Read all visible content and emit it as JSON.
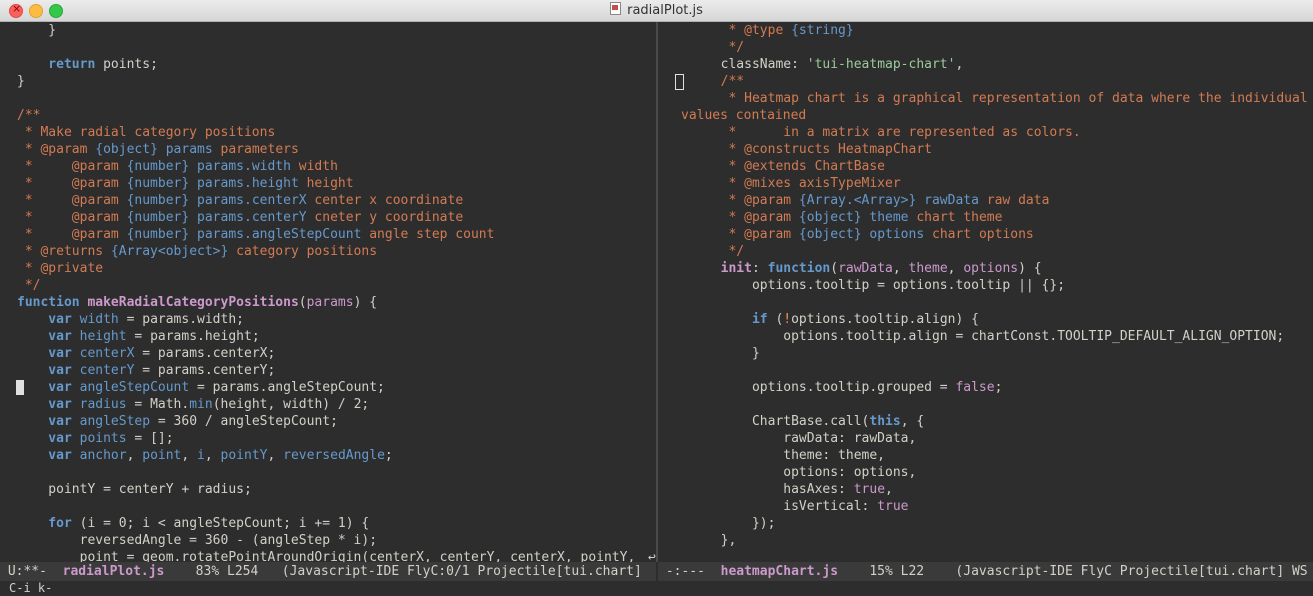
{
  "window": {
    "title": "radialPlot.js"
  },
  "left_pane": {
    "lines": [
      [
        [
          "",
          "    }"
        ]
      ],
      [
        [
          "",
          ""
        ]
      ],
      [
        [
          "k",
          "    return"
        ],
        [
          "",
          " points;"
        ]
      ],
      [
        [
          "",
          "}"
        ]
      ],
      [
        [
          "",
          ""
        ]
      ],
      [
        [
          "c",
          "/**"
        ]
      ],
      [
        [
          "c",
          " * Make radial category positions"
        ]
      ],
      [
        [
          "c",
          " * @param "
        ],
        [
          "t",
          "{object}"
        ],
        [
          "v",
          " params"
        ],
        [
          "c",
          " parameters"
        ]
      ],
      [
        [
          "c",
          " *     @param "
        ],
        [
          "t",
          "{number}"
        ],
        [
          "v",
          " params.width"
        ],
        [
          "c",
          " width"
        ]
      ],
      [
        [
          "c",
          " *     @param "
        ],
        [
          "t",
          "{number}"
        ],
        [
          "v",
          " params.height"
        ],
        [
          "c",
          " height"
        ]
      ],
      [
        [
          "c",
          " *     @param "
        ],
        [
          "t",
          "{number}"
        ],
        [
          "v",
          " params.centerX"
        ],
        [
          "c",
          " center x coordinate"
        ]
      ],
      [
        [
          "c",
          " *     @param "
        ],
        [
          "t",
          "{number}"
        ],
        [
          "v",
          " params.centerY"
        ],
        [
          "c",
          " cneter y coordinate"
        ]
      ],
      [
        [
          "c",
          " *     @param "
        ],
        [
          "t",
          "{number}"
        ],
        [
          "v",
          " params.angleStepCount"
        ],
        [
          "c",
          " angle step count"
        ]
      ],
      [
        [
          "c",
          " * @returns "
        ],
        [
          "t",
          "{Array<object>}"
        ],
        [
          "c",
          " category positions"
        ]
      ],
      [
        [
          "c",
          " * @private"
        ]
      ],
      [
        [
          "c",
          " */"
        ]
      ],
      [
        [
          "k",
          "function"
        ],
        [
          "",
          " "
        ],
        [
          "f",
          "makeRadialCategoryPositions"
        ],
        [
          "",
          "("
        ],
        [
          "p",
          "params"
        ],
        [
          "",
          ") {"
        ]
      ],
      [
        [
          "k",
          "    var"
        ],
        [
          "v",
          " width"
        ],
        [
          "",
          " = params.width;"
        ]
      ],
      [
        [
          "k",
          "    var"
        ],
        [
          "v",
          " height"
        ],
        [
          "",
          " = params.height;"
        ]
      ],
      [
        [
          "k",
          "    var"
        ],
        [
          "v",
          " centerX"
        ],
        [
          "",
          " = params.centerX;"
        ]
      ],
      [
        [
          "k",
          "    var"
        ],
        [
          "v",
          " centerY"
        ],
        [
          "",
          " = params.centerY;"
        ]
      ],
      [
        [
          "k",
          "    var"
        ],
        [
          "v",
          " angleStepCount"
        ],
        [
          "",
          " = params.angleStepCount;"
        ]
      ],
      [
        [
          "k",
          "    var"
        ],
        [
          "v",
          " radius"
        ],
        [
          "",
          " = Math."
        ],
        [
          "m",
          "min"
        ],
        [
          "",
          "(height, width) / 2;"
        ]
      ],
      [
        [
          "k",
          "    var"
        ],
        [
          "v",
          " angleStep"
        ],
        [
          "",
          " = 360 / angleStepCount;"
        ]
      ],
      [
        [
          "k",
          "    var"
        ],
        [
          "v",
          " points"
        ],
        [
          "",
          " = [];"
        ]
      ],
      [
        [
          "k",
          "    var"
        ],
        [
          "v",
          " anchor"
        ],
        [
          "",
          ", "
        ],
        [
          "v",
          "point"
        ],
        [
          "",
          ", "
        ],
        [
          "v",
          "i"
        ],
        [
          "",
          ", "
        ],
        [
          "v",
          "pointY"
        ],
        [
          "",
          ", "
        ],
        [
          "v",
          "reversedAngle"
        ],
        [
          "",
          ";"
        ]
      ],
      [
        [
          "",
          ""
        ]
      ],
      [
        [
          "",
          "    pointY = centerY + radius;"
        ]
      ],
      [
        [
          "",
          ""
        ]
      ],
      [
        [
          "k",
          "    for"
        ],
        [
          "",
          " (i = 0; i < angleStepCount; i += 1) {"
        ]
      ],
      [
        [
          "",
          "        reversedAngle = 360 - (angleStep * i);"
        ]
      ],
      [
        [
          "",
          "        point = geom.rotatePointAroundOrigin(centerX, centerY, centerX, pointY,"
        ]
      ]
    ]
  },
  "right_pane": {
    "lines": [
      [
        [
          "c",
          "   * @type "
        ],
        [
          "t",
          "{string}"
        ]
      ],
      [
        [
          "c",
          "   */"
        ]
      ],
      [
        [
          "",
          "  className: "
        ],
        [
          "s",
          "'tui-heatmap-chart'"
        ],
        [
          "",
          ","
        ]
      ],
      [
        [
          "c",
          "  /**"
        ]
      ],
      [
        [
          "c",
          "   * Heatmap chart is a graphical representation of data where the individual"
        ]
      ],
      [
        [
          "c",
          "values contained"
        ]
      ],
      [
        [
          "c",
          "   *      in a matrix are represented as colors."
        ]
      ],
      [
        [
          "c",
          "   * @constructs HeatmapChart"
        ]
      ],
      [
        [
          "c",
          "   * @extends ChartBase"
        ]
      ],
      [
        [
          "c",
          "   * @mixes axisTypeMixer"
        ]
      ],
      [
        [
          "c",
          "   * @param "
        ],
        [
          "t",
          "{Array.<Array>}"
        ],
        [
          "v",
          " rawData"
        ],
        [
          "c",
          " raw data"
        ]
      ],
      [
        [
          "c",
          "   * @param "
        ],
        [
          "t",
          "{object}"
        ],
        [
          "v",
          " theme"
        ],
        [
          "c",
          " chart theme"
        ]
      ],
      [
        [
          "c",
          "   * @param "
        ],
        [
          "t",
          "{object}"
        ],
        [
          "v",
          " options"
        ],
        [
          "c",
          " chart options"
        ]
      ],
      [
        [
          "c",
          "   */"
        ]
      ],
      [
        [
          "f",
          "  init"
        ],
        [
          "",
          ": "
        ],
        [
          "k",
          "function"
        ],
        [
          "",
          "("
        ],
        [
          "p",
          "rawData"
        ],
        [
          "",
          ", "
        ],
        [
          "p",
          "theme"
        ],
        [
          "",
          ", "
        ],
        [
          "p",
          "options"
        ],
        [
          "",
          ") {"
        ]
      ],
      [
        [
          "",
          "      options.tooltip = options.tooltip || {};"
        ]
      ],
      [
        [
          "",
          ""
        ]
      ],
      [
        [
          "k",
          "      if"
        ],
        [
          "",
          " ("
        ],
        [
          "n",
          "!"
        ],
        [
          "",
          "options.tooltip.align) {"
        ]
      ],
      [
        [
          "",
          "          options.tooltip.align = chartConst.TOOLTIP_DEFAULT_ALIGN_OPTION;"
        ]
      ],
      [
        [
          "",
          "      }"
        ]
      ],
      [
        [
          "",
          ""
        ]
      ],
      [
        [
          "",
          "      options.tooltip.grouped = "
        ],
        [
          "b",
          "false"
        ],
        [
          "",
          ";"
        ]
      ],
      [
        [
          "",
          ""
        ]
      ],
      [
        [
          "",
          "      ChartBase.call("
        ],
        [
          "k",
          "this"
        ],
        [
          "",
          ", {"
        ]
      ],
      [
        [
          "",
          "          rawData: rawData,"
        ]
      ],
      [
        [
          "",
          "          theme: theme,"
        ]
      ],
      [
        [
          "",
          "          options: options,"
        ]
      ],
      [
        [
          "",
          "          hasAxes: "
        ],
        [
          "b",
          "true"
        ],
        [
          "",
          ","
        ]
      ],
      [
        [
          "",
          "          isVertical: "
        ],
        [
          "b",
          "true"
        ]
      ],
      [
        [
          "",
          "      });"
        ]
      ],
      [
        [
          "",
          "  },"
        ]
      ]
    ]
  },
  "modeline_left": {
    "state": " U:**-  ",
    "file": "radialPlot.js",
    "info": "    83% L254   (Javascript-IDE FlyC:0/1 Projectile[tui.chart]"
  },
  "modeline_right": {
    "state": " -:---  ",
    "file": "heatmapChart.js",
    "info": "    15% L22    (Javascript-IDE FlyC Projectile[tui.chart] WS"
  },
  "minibuffer": {
    "text": "C-i k-"
  }
}
